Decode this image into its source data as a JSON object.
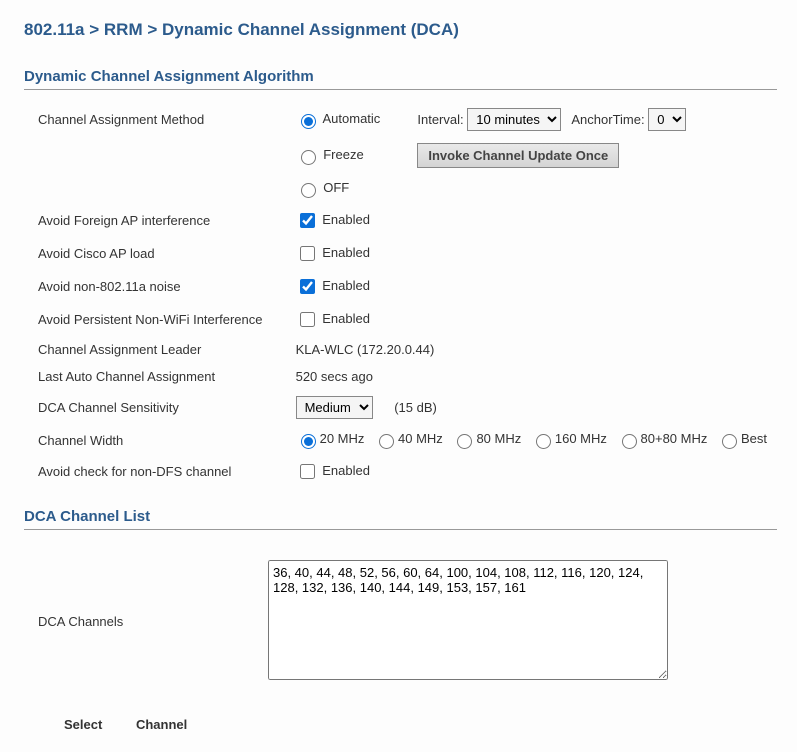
{
  "breadcrumb": "802.11a > RRM > Dynamic Channel Assignment (DCA)",
  "section_algorithm": "Dynamic Channel Assignment Algorithm",
  "labels": {
    "method": "Channel Assignment Method",
    "foreign_ap": "Avoid Foreign AP interference",
    "cisco_load": "Avoid Cisco AP load",
    "noise": "Avoid non-802.11a noise",
    "persistent": "Avoid Persistent Non-WiFi Interference",
    "leader": "Channel Assignment Leader",
    "last_auto": "Last Auto Channel Assignment",
    "sensitivity": "DCA Channel Sensitivity",
    "width": "Channel Width",
    "avoid_dfs": "Avoid check for non-DFS channel",
    "dca_channels": "DCA Channels"
  },
  "radio": {
    "automatic": "Automatic",
    "freeze": "Freeze",
    "off": "OFF"
  },
  "interval_label": "Interval:",
  "interval_value": "10 minutes",
  "anchor_label": "AnchorTime:",
  "anchor_value": "0",
  "invoke_btn": "Invoke Channel Update Once",
  "enabled_text": "Enabled",
  "leader_value": "KLA-WLC (172.20.0.44)",
  "last_auto_value": "520 secs ago",
  "sensitivity_value": "Medium",
  "sensitivity_paren": "(15 dB)",
  "width_options": {
    "w20": "20 MHz",
    "w40": "40 MHz",
    "w80": "80 MHz",
    "w160": "160 MHz",
    "w8080": "80+80 MHz",
    "wbest": "Best"
  },
  "section_channel_list": "DCA Channel List",
  "channels_value": "36, 40, 44, 48, 52, 56, 60, 64, 100, 104, 108, 112, 116, 120, 124, 128, 132, 136, 140, 144, 149, 153, 157, 161",
  "footer": {
    "select": "Select",
    "channel": "Channel"
  }
}
